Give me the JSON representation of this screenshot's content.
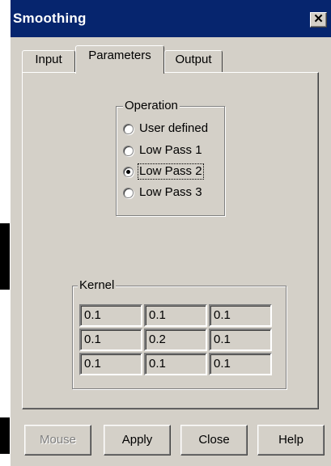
{
  "window": {
    "title": "Smoothing",
    "close_glyph": "✕"
  },
  "tabs": [
    {
      "label": "Input",
      "active": false
    },
    {
      "label": "Parameters",
      "active": true
    },
    {
      "label": "Output",
      "active": false
    }
  ],
  "operation": {
    "legend": "Operation",
    "options": [
      {
        "label": "User defined",
        "selected": false
      },
      {
        "label": "Low Pass 1",
        "selected": false
      },
      {
        "label": "Low Pass 2",
        "selected": true
      },
      {
        "label": "Low Pass 3",
        "selected": false
      }
    ]
  },
  "kernel": {
    "legend": "Kernel",
    "rows": [
      [
        "0.1",
        "0.1",
        "0.1"
      ],
      [
        "0.1",
        "0.2",
        "0.1"
      ],
      [
        "0.1",
        "0.1",
        "0.1"
      ]
    ]
  },
  "buttons": {
    "mouse": {
      "label": "Mouse",
      "enabled": false
    },
    "apply": {
      "label": "Apply",
      "enabled": true
    },
    "close": {
      "label": "Close",
      "enabled": true
    },
    "help": {
      "label": "Help",
      "enabled": true
    }
  }
}
